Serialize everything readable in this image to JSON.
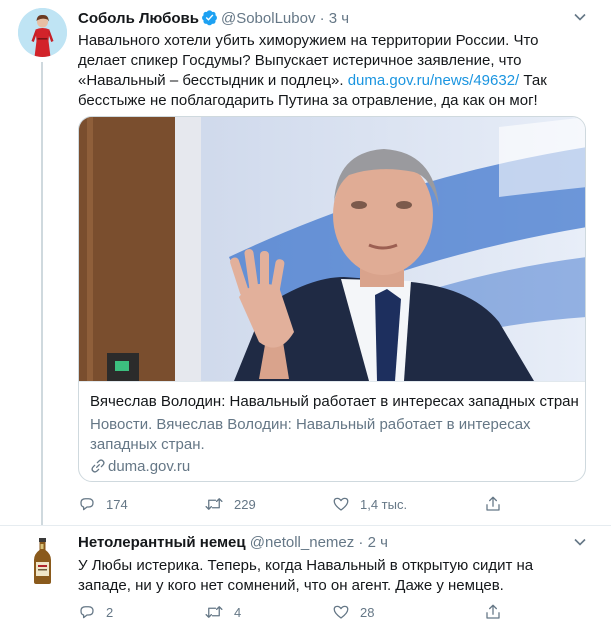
{
  "tweets": [
    {
      "author": {
        "name": "Соболь Любовь",
        "handle": "@SobolLubov",
        "verified": true
      },
      "separator": "·",
      "time": "3 ч",
      "text_before_link": "Навального хотели убить химоружием на территории России. Что делает спикер Госдумы? Выпускает истеричное заявление, что «Навальный – бесстыдник и подлец». ",
      "link": "duma.gov.ru/news/49632/",
      "text_after_link": " Так бесстыже не поблагодарить Путина за отравление, да как он мог!",
      "card": {
        "title": "Вячеслав Володин: Навальный работает в интересах западных стран",
        "description": "Новости. Вячеслав Володин: Навальный работает в интересах западных стран.",
        "domain": "duma.gov.ru"
      },
      "stats": {
        "replies": "174",
        "retweets": "229",
        "likes": "1,4 тыс."
      }
    },
    {
      "author": {
        "name": "Нетолерантный немец",
        "handle": "@netoll_nemez",
        "verified": false
      },
      "separator": "·",
      "time": "2 ч",
      "text": "У Любы истерика. Теперь, когда Навальный в открытую сидит на западе, ни у кого нет сомнений, что он агент. Даже у немцев.",
      "stats": {
        "replies": "2",
        "retweets": "4",
        "likes": "28"
      }
    }
  ],
  "icons": {
    "verified": "verified-badge-icon",
    "caret": "chevron-down-icon",
    "reply": "reply-icon",
    "retweet": "retweet-icon",
    "like": "heart-icon",
    "share": "share-icon",
    "link": "link-icon"
  },
  "colors": {
    "link": "#1b95e0",
    "verified": "#1da1f2",
    "secondary_text": "#657786",
    "border": "#cfd9de"
  }
}
